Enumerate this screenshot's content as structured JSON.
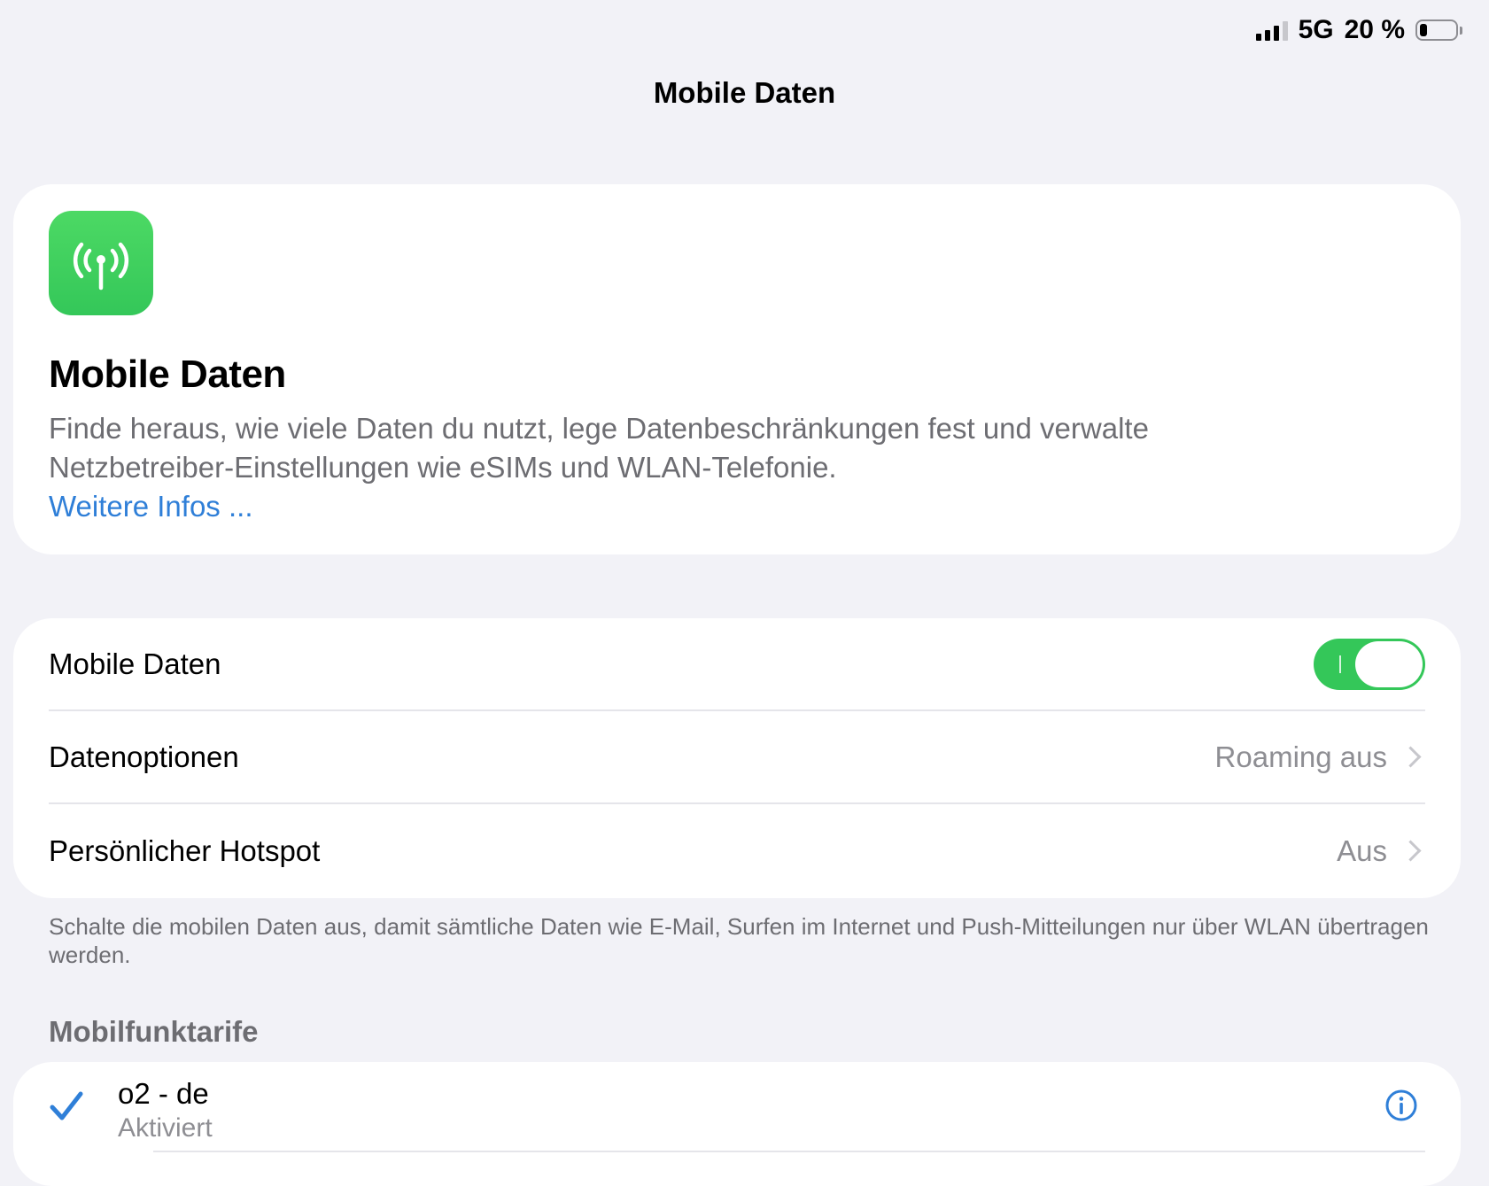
{
  "status_bar": {
    "network": "5G",
    "battery_percent_label": "20 %",
    "battery_level": 0.2,
    "signal_bars": 3
  },
  "nav": {
    "title": "Mobile Daten"
  },
  "hero": {
    "icon": "antenna-radiowaves-icon",
    "title": "Mobile Daten",
    "description": "Finde heraus, wie viele Daten du nutzt, lege Datenbeschränkungen fest und verwalte Netzbetreiber-Einstellungen wie eSIMs und WLAN-Telefonie.",
    "link": "Weitere Infos ..."
  },
  "settings": {
    "mobile_data": {
      "label": "Mobile Daten",
      "enabled": true
    },
    "data_options": {
      "label": "Datenoptionen",
      "value": "Roaming aus"
    },
    "hotspot": {
      "label": "Persönlicher Hotspot",
      "value": "Aus"
    },
    "footnote": "Schalte die mobilen Daten aus, damit sämtliche Daten wie E-Mail, Surfen im Internet und Push-Mitteilungen nur über WLAN übertragen werden."
  },
  "plans": {
    "header": "Mobilfunktarife",
    "items": [
      {
        "name": "o2 - de",
        "status": "Aktiviert",
        "selected": true
      }
    ]
  },
  "colors": {
    "background": "#f2f2f7",
    "accent_green": "#34c759",
    "link_blue": "#2f7fd8",
    "secondary_text": "#6d6d72"
  }
}
